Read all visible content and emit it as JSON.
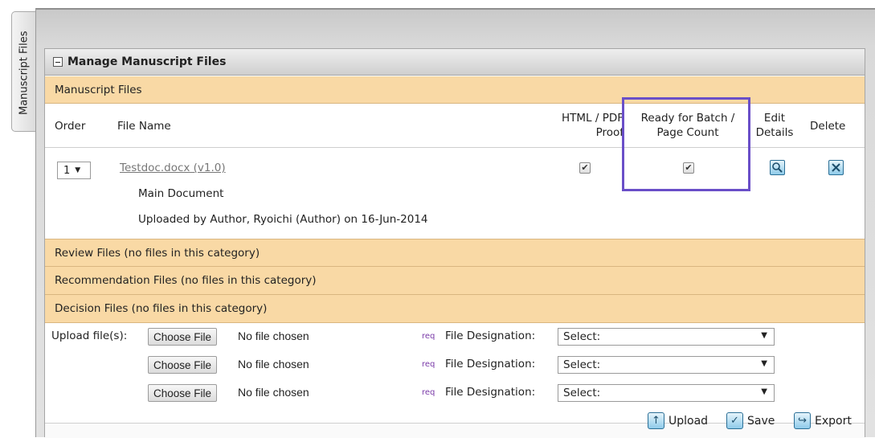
{
  "side_tab": {
    "label": "Manuscript Files"
  },
  "panel": {
    "title": "Manage Manuscript Files"
  },
  "section": {
    "title": "Manuscript Files",
    "headers": {
      "order": "Order",
      "file_name": "File Name",
      "html_pdf_line1": "HTML / PDF",
      "html_pdf_line2": "Proof",
      "ready_line1": "Ready for Batch /",
      "ready_line2": "Page Count",
      "edit_line1": "Edit",
      "edit_line2": "Details",
      "delete": "Delete"
    }
  },
  "file": {
    "order": "1",
    "name": "Testdoc.docx (v1.0)",
    "type": "Main Document",
    "uploaded": "Uploaded by Author, Ryoichi (Author) on 16-Jun-2014",
    "html_pdf_checked": true,
    "ready_checked": true
  },
  "categories": [
    "Review Files (no files in this category)",
    "Recommendation Files (no files in this category)",
    "Decision Files (no files in this category)"
  ],
  "upload": {
    "label": "Upload file(s):",
    "rows": [
      {
        "button": "Choose File",
        "status": "No file chosen",
        "req": "req",
        "designation_label": "File Designation:",
        "designation_value": "Select:"
      },
      {
        "button": "Choose File",
        "status": "No file chosen",
        "req": "req",
        "designation_label": "File Designation:",
        "designation_value": "Select:"
      },
      {
        "button": "Choose File",
        "status": "No file chosen",
        "req": "req",
        "designation_label": "File Designation:",
        "designation_value": "Select:"
      }
    ]
  },
  "actions": {
    "upload": "Upload",
    "save": "Save",
    "export": "Export"
  },
  "colors": {
    "band": "#f9d9a5",
    "highlight": "#6a4fc8",
    "req": "#7a3aa8"
  }
}
